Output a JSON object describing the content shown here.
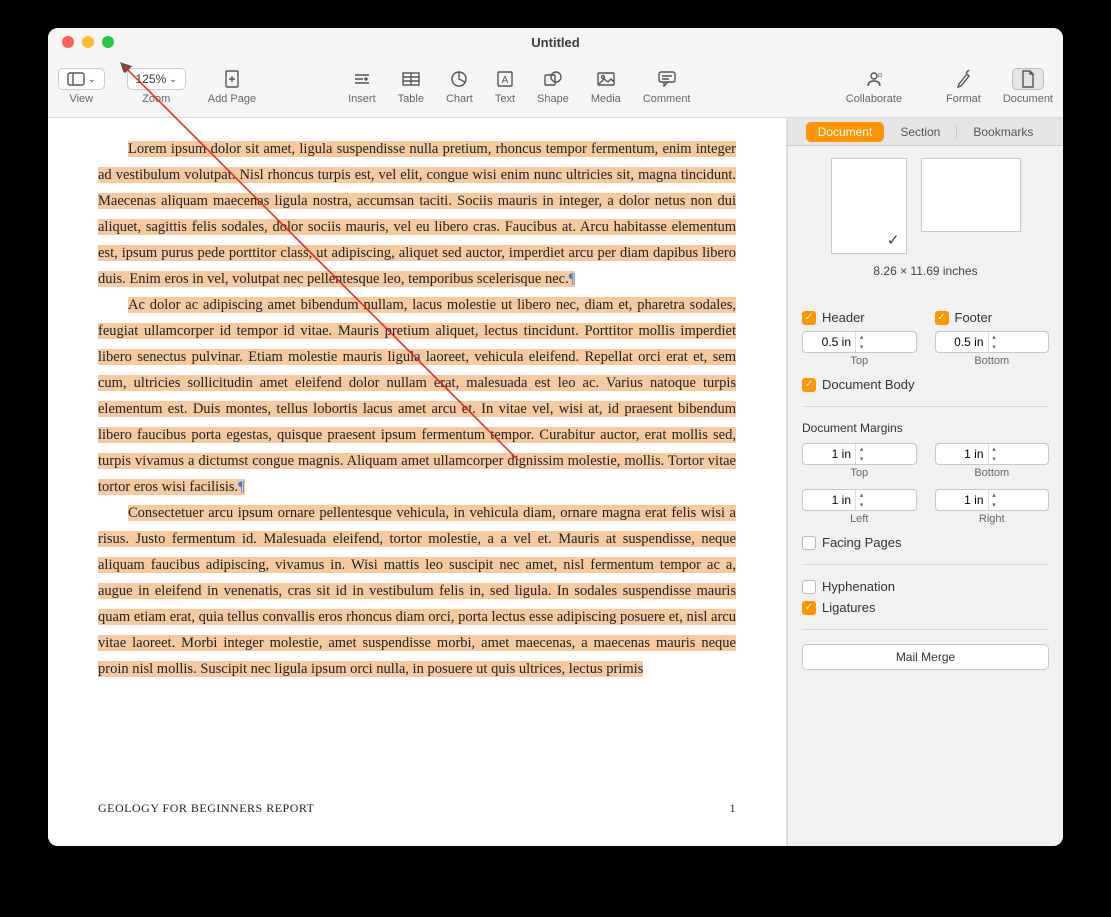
{
  "window": {
    "title": "Untitled"
  },
  "toolbar": {
    "view": "View",
    "zoom": "Zoom",
    "zoom_value": "125%",
    "add_page": "Add Page",
    "insert": "Insert",
    "table": "Table",
    "chart": "Chart",
    "text": "Text",
    "shape": "Shape",
    "media": "Media",
    "comment": "Comment",
    "collaborate": "Collaborate",
    "format": "Format",
    "document": "Document"
  },
  "document": {
    "para1": "Lorem ipsum dolor sit amet, ligula suspendisse nulla pretium, rhoncus tempor fermentum, enim integer ad vestibulum volutpat. Nisl rhoncus turpis est, vel elit, congue wisi enim nunc ultricies sit, magna tincidunt. Maecenas aliquam maecenas ligula nostra, accumsan taciti. Sociis mauris in integer, a dolor netus non dui aliquet, sagittis felis sodales, dolor sociis mauris, vel eu libero cras. Faucibus at. Arcu habitasse elementum est, ipsum purus pede porttitor class, ut adipiscing, aliquet sed auctor, imperdiet arcu per diam dapibus libero duis. Enim eros in vel, volutpat nec pellentesque leo, temporibus scelerisque nec.",
    "para2": "Ac dolor ac adipiscing amet bibendum nullam, lacus molestie ut libero nec, diam et, pharetra sodales, feugiat ullamcorper id tempor id vitae. Mauris pretium aliquet, lectus tincidunt. Porttitor mollis imperdiet libero senectus pulvinar. Etiam molestie mauris ligula laoreet, vehicula eleifend. Repellat orci erat et, sem cum, ultricies sollicitudin amet eleifend dolor nullam erat, malesuada est leo ac. Varius natoque turpis elementum est. Duis montes, tellus lobortis lacus amet arcu et. In vitae vel, wisi at, id praesent bibendum libero faucibus porta egestas, quisque praesent ipsum fermentum tempor. Curabitur auctor, erat mollis sed, turpis vivamus a dictumst congue magnis. Aliquam amet ullamcorper dignissim molestie, mollis. Tortor vitae tortor eros wisi facilisis.",
    "para3": "Consectetuer arcu ipsum ornare pellentesque vehicula, in vehicula diam, ornare magna erat felis wisi a risus. Justo fermentum id. Malesuada eleifend, tortor molestie, a a vel et. Mauris at suspendisse, neque aliquam faucibus adipiscing, vivamus in. Wisi mattis leo suscipit nec amet, nisl fermentum tempor ac a, augue in eleifend in venenatis, cras sit id in vestibulum felis in, sed ligula. In sodales suspendisse mauris quam etiam erat, quia tellus convallis eros rhoncus diam orci, porta lectus esse adipiscing posuere et, nisl arcu vitae laoreet. Morbi integer molestie, amet suspendisse morbi, amet maecenas, a maecenas mauris neque proin nisl mollis. Suscipit nec ligula ipsum orci nulla, in posuere ut quis ultrices, lectus primis",
    "footer_left": "GEOLOGY FOR BEGINNERS REPORT",
    "footer_right": "1",
    "pilcrow": "¶"
  },
  "inspector": {
    "tabs": {
      "document": "Document",
      "section": "Section",
      "bookmarks": "Bookmarks"
    },
    "page_size": "8.26 × 11.69 inches",
    "header": "Header",
    "footer": "Footer",
    "header_val": "0.5 in",
    "footer_val": "0.5 in",
    "top": "Top",
    "bottom": "Bottom",
    "left": "Left",
    "right": "Right",
    "document_body": "Document Body",
    "margins_title": "Document Margins",
    "margin_top": "1 in",
    "margin_bottom": "1 in",
    "margin_left": "1 in",
    "margin_right": "1 in",
    "facing_pages": "Facing Pages",
    "hyphenation": "Hyphenation",
    "ligatures": "Ligatures",
    "mail_merge": "Mail Merge"
  }
}
